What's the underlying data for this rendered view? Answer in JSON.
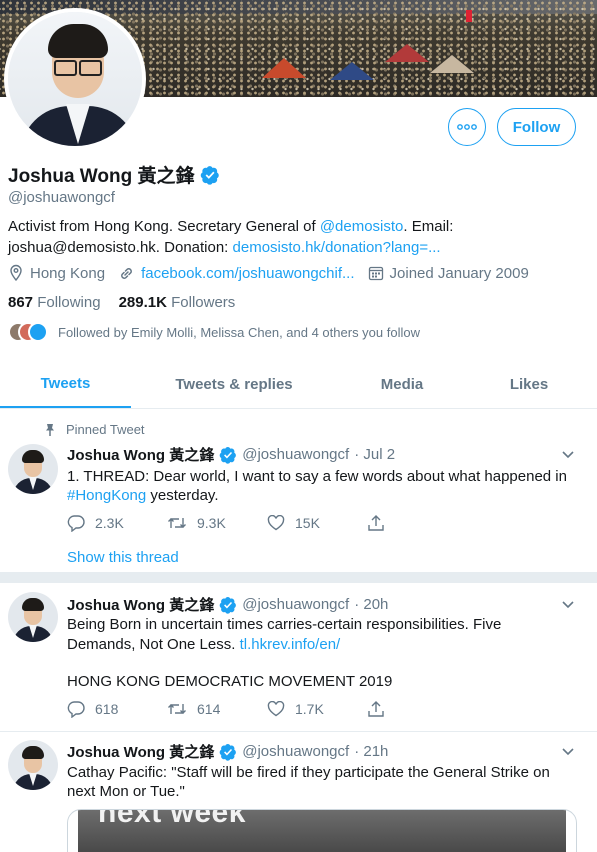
{
  "profile": {
    "name": "Joshua Wong 黃之鋒",
    "handle": "@joshuawongcf",
    "bio_prefix": "Activist from Hong Kong. Secretary General of ",
    "bio_mention": "@demosisto",
    "bio_middle": ". Email: joshua@demosisto.hk. Donation: ",
    "bio_link": "demosisto.hk/donation?lang=...",
    "location": "Hong Kong",
    "website": "facebook.com/joshuawongchif...",
    "joined": "Joined January 2009",
    "following_count": "867",
    "following_label": "Following",
    "followers_count": "289.1K",
    "followers_label": "Followers",
    "followed_by": "Followed by Emily Molli, Melissa Chen, and 4 others you follow",
    "follow_label": "Follow"
  },
  "tabs": [
    "Tweets",
    "Tweets & replies",
    "Media",
    "Likes"
  ],
  "tweets": [
    {
      "pinned_label": "Pinned Tweet",
      "name": "Joshua Wong 黃之鋒",
      "handle": "@joshuawongcf",
      "time": "· Jul 2",
      "text_line1": "1. THREAD: Dear world, I want to say a few words about what happened in",
      "hashtag": "#HongKong",
      "text_after_hashtag": " yesterday.",
      "replies": "2.3K",
      "retweets": "9.3K",
      "likes": "15K",
      "thread_label": "Show this thread"
    },
    {
      "name": "Joshua Wong 黃之鋒",
      "handle": "@joshuawongcf",
      "time": "· 20h",
      "text_line1": "Being Born in uncertain times carries-certain responsibilities. Five",
      "text_line2_prefix": "Demands, Not One Less. ",
      "link": "tl.hkrev.info/en/",
      "text_line3": "HONG KONG DEMOCRATIC MOVEMENT 2019",
      "replies": "618",
      "retweets": "614",
      "likes": "1.7K"
    },
    {
      "name": "Joshua Wong 黃之鋒",
      "handle": "@joshuawongcf",
      "time": "· 21h",
      "text_line1": "Cathay Pacific:  \"Staff will be fired if they participate the General Strike on",
      "text_line2": "next Mon or Tue.\"",
      "media_text": "next week"
    }
  ],
  "colors": {
    "accent": "#1da1f2",
    "muted": "#657786",
    "text": "#14171a",
    "divider": "#e6ecf0"
  }
}
